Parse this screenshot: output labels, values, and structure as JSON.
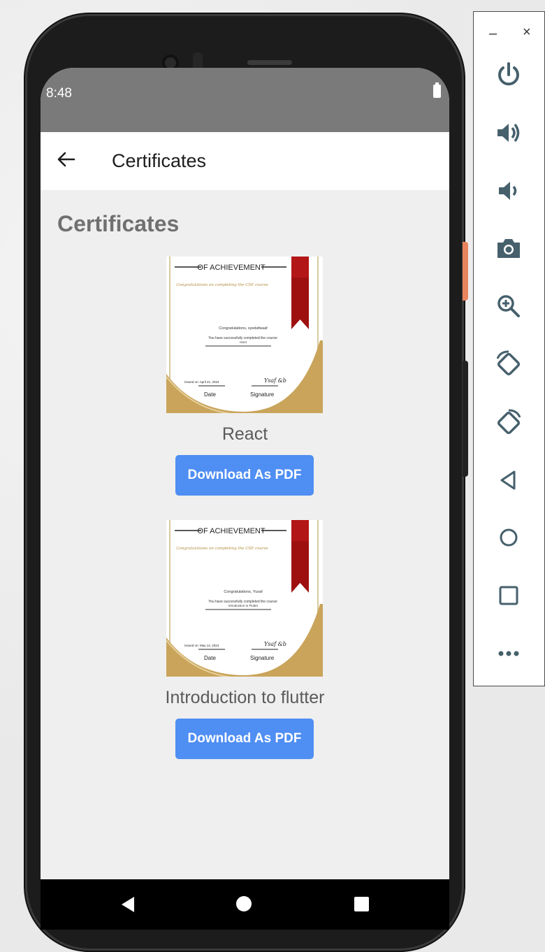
{
  "status": {
    "time": "8:48"
  },
  "appbar": {
    "title": "Certificates"
  },
  "page": {
    "heading": "Certificates"
  },
  "certificates": [
    {
      "banner": "OF ACHIEVEMENT",
      "script_line": "Congratulations on completing the CSE course",
      "congrats": "Congratulations, syedafwaaf",
      "completed": "You have successfully completed the course:",
      "course_small": "react",
      "issued": "Issued on: April 21, 2024",
      "date_label": "Date",
      "signature_label": "Signature",
      "name": "React",
      "button": "Download As PDF"
    },
    {
      "banner": "OF ACHIEVEMENT",
      "script_line": "Congratulations on completing the CSE course",
      "congrats": "Congratulations, Yusaf",
      "completed": "You have successfully completed the course:",
      "course_small": "Introduction to Flutter",
      "issued": "Issued on: May 14, 2024",
      "date_label": "Date",
      "signature_label": "Signature",
      "name": "Introduction to flutter",
      "button": "Download As PDF"
    }
  ],
  "panel": {
    "minimize": "–",
    "close": "×",
    "tools": [
      "power-icon",
      "volume-up-icon",
      "volume-down-icon",
      "camera-icon",
      "zoom-in-icon",
      "rotate-left-icon",
      "rotate-right-icon",
      "back-icon",
      "home-icon",
      "overview-icon",
      "more-icon"
    ]
  },
  "colors": {
    "accent": "#4f8ef3",
    "ribbon": "#9e1010",
    "gold": "#c9a45a",
    "statusbar": "#7a7a7a"
  }
}
